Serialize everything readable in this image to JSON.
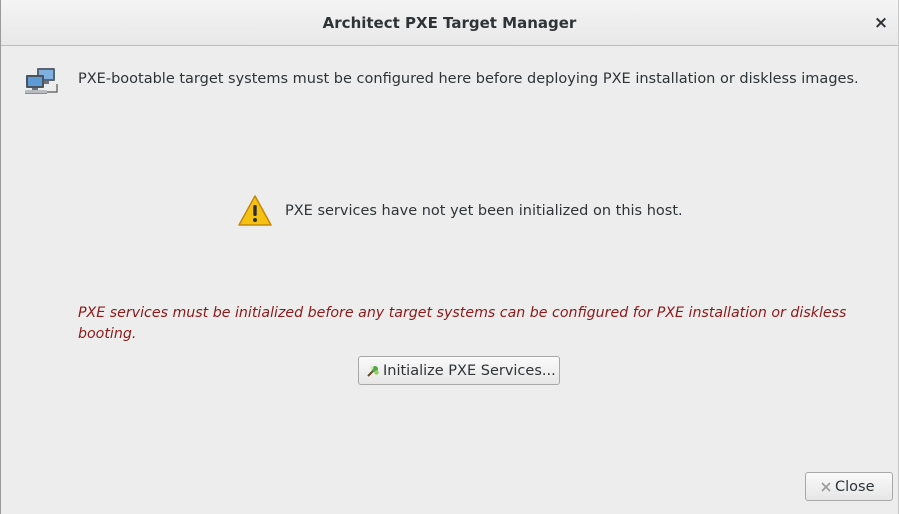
{
  "window": {
    "title": "Architect PXE Target Manager",
    "close_glyph": "×"
  },
  "info": {
    "icon": "network-computers-icon",
    "text": "PXE-bootable target systems must be configured here before deploying PXE installation or diskless images."
  },
  "warning": {
    "icon": "warning-icon",
    "text": "PXE services have not yet been initialized on this host."
  },
  "error": {
    "text": "PXE services must be initialized before any target systems can be configured for PXE installation or diskless booting.",
    "color": "#8b1a1a"
  },
  "buttons": {
    "initialize_label": "Initialize PXE Services...",
    "initialize_icon": "initialize-icon",
    "close_label": "Close",
    "close_icon": "close-icon"
  }
}
